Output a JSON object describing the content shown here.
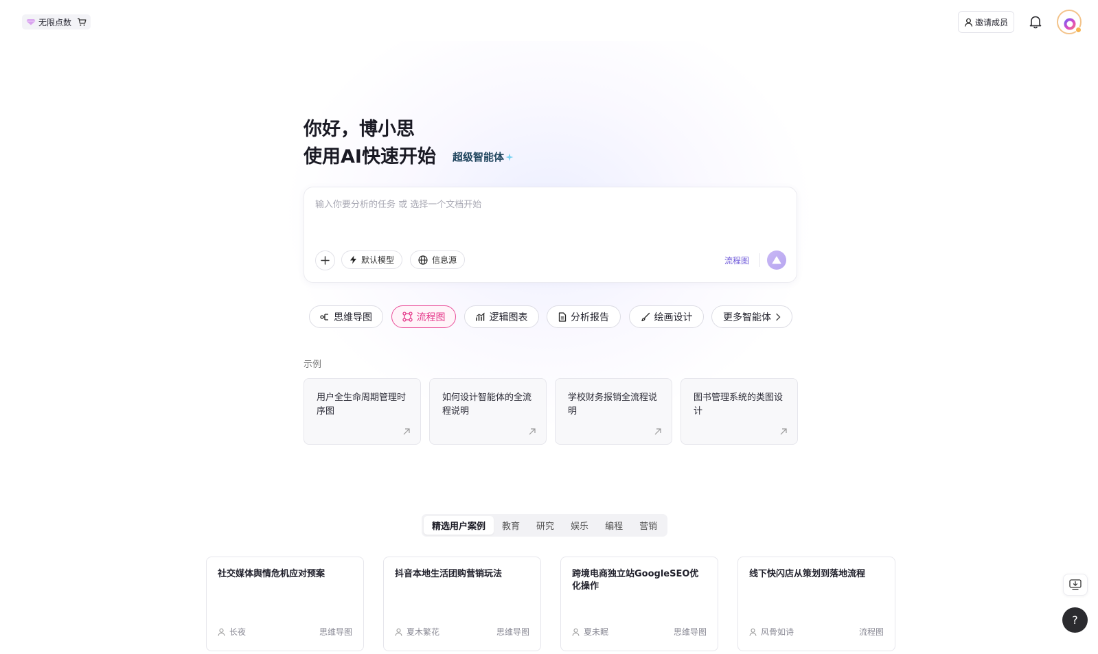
{
  "header": {
    "credits_label": "无限点数",
    "invite_label": "邀请成员"
  },
  "hero": {
    "greeting": "你好，博小思",
    "subtitle": "使用AI快速开始",
    "badge": "超级智能体"
  },
  "input": {
    "placeholder": "输入你要分析的任务 或 选择一个文档开始",
    "model_label": "默认模型",
    "source_label": "信息源",
    "mode_tag": "流程图"
  },
  "categories": [
    {
      "label": "思维导图",
      "active": false
    },
    {
      "label": "流程图",
      "active": true
    },
    {
      "label": "逻辑图表",
      "active": false
    },
    {
      "label": "分析报告",
      "active": false
    },
    {
      "label": "绘画设计",
      "active": false
    },
    {
      "label": "更多智能体",
      "active": false
    }
  ],
  "examples": {
    "title": "示例",
    "items": [
      "用户全生命周期管理时序图",
      "如何设计智能体的全流程说明",
      "学校财务报销全流程说明",
      "图书管理系统的类图设计"
    ]
  },
  "tabs": [
    {
      "label": "精选用户案例",
      "active": true
    },
    {
      "label": "教育",
      "active": false
    },
    {
      "label": "研究",
      "active": false
    },
    {
      "label": "娱乐",
      "active": false
    },
    {
      "label": "编程",
      "active": false
    },
    {
      "label": "营销",
      "active": false
    }
  ],
  "cases": [
    {
      "title": "社交媒体舆情危机应对预案",
      "author": "长夜",
      "type": "思维导图"
    },
    {
      "title": "抖音本地生活团购营销玩法",
      "author": "夏木繁花",
      "type": "思维导图"
    },
    {
      "title": "跨境电商独立站GoogleSEO优化操作",
      "author": "夏未眠",
      "type": "思维导图"
    },
    {
      "title": "线下快闪店从策划到落地流程",
      "author": "风骨如诗",
      "type": "流程图"
    }
  ],
  "help_label": "?",
  "colors": {
    "accent_pink": "#e4388a",
    "accent_purple": "#6b55d9",
    "send_button": "#b7a6f0",
    "help_button": "#2b2b2f"
  }
}
